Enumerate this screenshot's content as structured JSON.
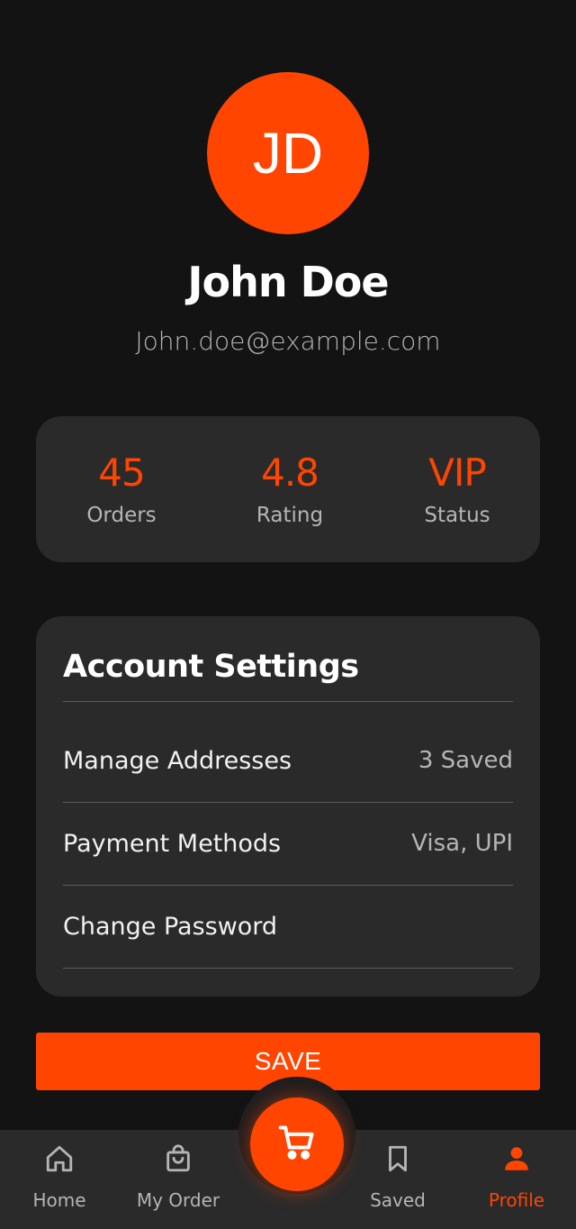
{
  "profile": {
    "initials": "JD",
    "name": "John Doe",
    "email": "John.doe@example.com"
  },
  "stats": [
    {
      "value": "45",
      "label": "Orders"
    },
    {
      "value": "4.8",
      "label": "Rating"
    },
    {
      "value": "VIP",
      "label": "Status"
    }
  ],
  "settings": {
    "title": "Account Settings",
    "items": [
      {
        "label": "Manage Addresses",
        "value": "3 Saved"
      },
      {
        "label": "Payment Methods",
        "value": "Visa, UPI"
      },
      {
        "label": "Change Password",
        "value": ""
      }
    ]
  },
  "save_button": {
    "label": "SAVE"
  },
  "bottom_nav": {
    "items": [
      {
        "label": "Home",
        "icon": "home-icon"
      },
      {
        "label": "My Order",
        "icon": "shopping-bag-icon"
      },
      {
        "label": "Saved",
        "icon": "bookmark-icon"
      },
      {
        "label": "Profile",
        "icon": "person-icon",
        "active": true
      }
    ],
    "center": {
      "icon": "cart-icon"
    }
  },
  "colors": {
    "accent": "#ff4500",
    "background": "#131313",
    "card": "#2a2a2b",
    "muted_text": "#b5b5b5"
  }
}
